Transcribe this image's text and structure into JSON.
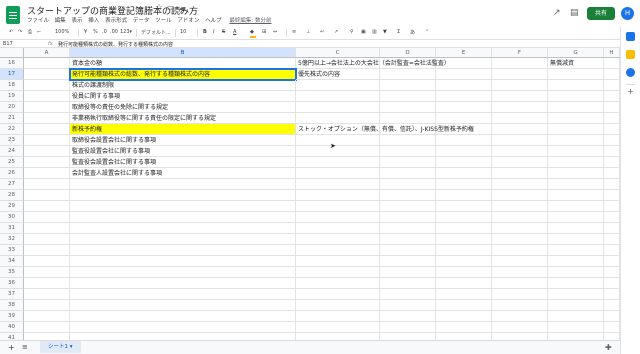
{
  "app": {
    "title": "スタートアップの商業登記簿謄本の読み方",
    "menu": [
      "ファイル",
      "編集",
      "表示",
      "挿入",
      "表示形式",
      "データ",
      "ツール",
      "アドオン",
      "ヘルプ"
    ],
    "last_edit": "最終編集: 数分前",
    "share_label": "共有",
    "avatar_letter": "H"
  },
  "toolbar": {
    "zoom": "100%",
    "currency": "¥",
    "percent": "%",
    "decimal_dec": ".0",
    "decimal_inc": ".00",
    "number_format": "123▾",
    "font": "デフォルト...",
    "font_size": "10",
    "bold": "B",
    "italic": "I",
    "strike": "S",
    "text_color": "A",
    "fill_color": "#fbbc04"
  },
  "formula_bar": {
    "cell_ref": "B17",
    "fx": "fx",
    "content": "発行可能種類株式の総数、発行する種類株式の内容"
  },
  "columns": [
    "A",
    "B",
    "C",
    "D",
    "E",
    "F",
    "G",
    "H"
  ],
  "selected_column": "B",
  "selected_row": 17,
  "rows": [
    {
      "num": 16,
      "cells": {
        "B": "資本金の額",
        "C": "5億円以上→会社法上の大会社（会計監査=会社法監査）",
        "G": "無償減資"
      }
    },
    {
      "num": 17,
      "cells": {
        "B": "発行可能種類株式の総数、発行する種類株式の内容",
        "C": "優先株式の内容"
      },
      "highlight": [
        "B"
      ],
      "active": "B"
    },
    {
      "num": 18,
      "cells": {
        "B": "株式の譲渡制限"
      }
    },
    {
      "num": 19,
      "cells": {
        "B": "役員に関する事項"
      }
    },
    {
      "num": 20,
      "cells": {
        "B": "取締役等の責任の免除に関する規定"
      }
    },
    {
      "num": 21,
      "cells": {
        "B": "非業務執行取締役等に関する責任の限定に関する規定"
      }
    },
    {
      "num": 22,
      "cells": {
        "B": "新株予約権",
        "C": "ストック・オプション（無償、有償、信託）、J-KISS型新株予約権"
      },
      "highlight": [
        "B"
      ]
    },
    {
      "num": 23,
      "cells": {
        "B": "取締役会設置会社に関する事項"
      }
    },
    {
      "num": 24,
      "cells": {
        "B": "監査役設置会社に関する事項"
      }
    },
    {
      "num": 25,
      "cells": {
        "B": "監査役会設置会社に関する事項"
      }
    },
    {
      "num": 26,
      "cells": {
        "B": "会計監査人設置会社に関する事項"
      }
    },
    {
      "num": 27,
      "cells": {}
    },
    {
      "num": 28,
      "cells": {}
    },
    {
      "num": 29,
      "cells": {}
    },
    {
      "num": 30,
      "cells": {}
    },
    {
      "num": 31,
      "cells": {}
    },
    {
      "num": 32,
      "cells": {}
    },
    {
      "num": 33,
      "cells": {}
    },
    {
      "num": 34,
      "cells": {}
    },
    {
      "num": 35,
      "cells": {}
    },
    {
      "num": 36,
      "cells": {}
    },
    {
      "num": 37,
      "cells": {}
    },
    {
      "num": 38,
      "cells": {}
    },
    {
      "num": 39,
      "cells": {}
    },
    {
      "num": 40,
      "cells": {}
    },
    {
      "num": 41,
      "cells": {}
    }
  ],
  "sheet_tabs": [
    "シート1 ▾"
  ],
  "colors": {
    "highlight": "#ffff00",
    "accent": "#1a73e8",
    "share": "#188038"
  }
}
